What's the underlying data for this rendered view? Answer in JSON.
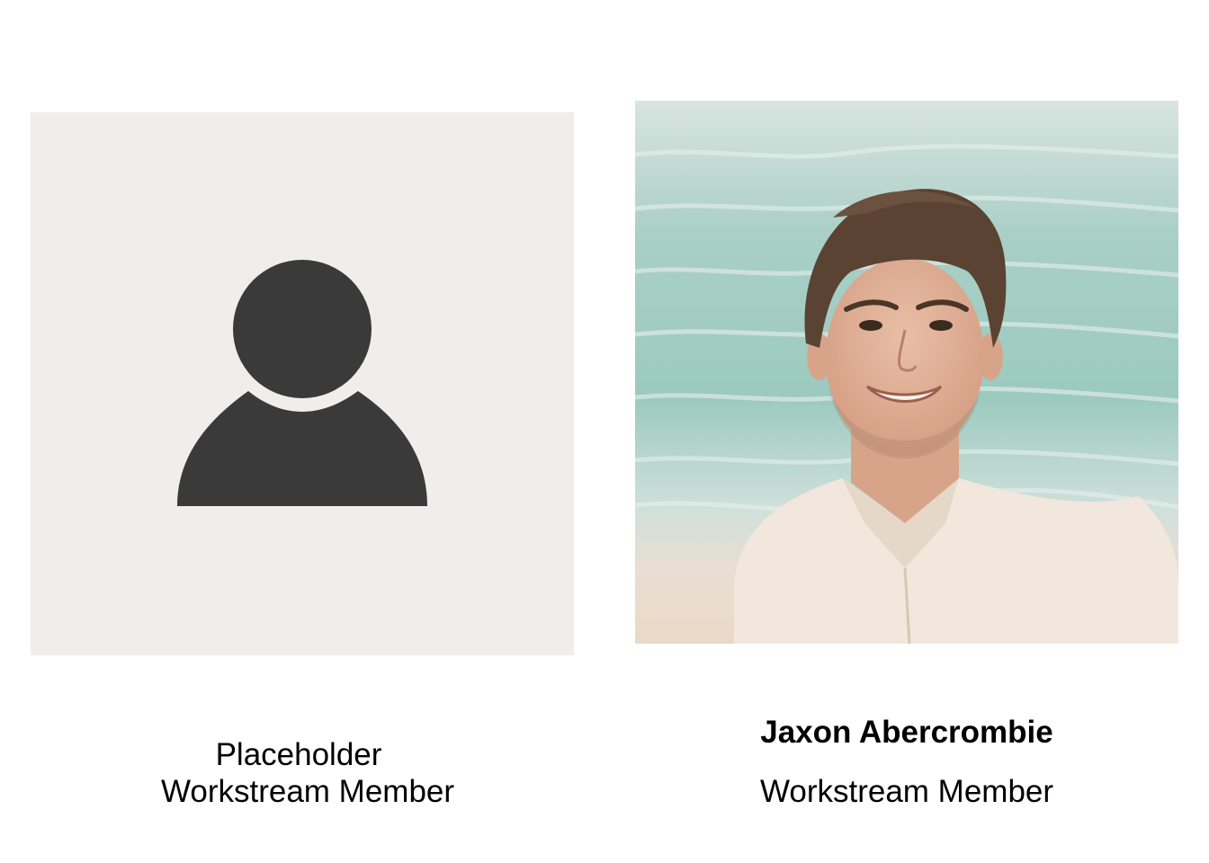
{
  "members": [
    {
      "name": "Placeholder",
      "role": "Workstream Member",
      "photo": "person-silhouette-icon"
    },
    {
      "name": "Jaxon Abercrombie",
      "role": "Workstream Member",
      "photo": "portrait-photo"
    }
  ],
  "colors": {
    "placeholder_background": "#efeeeb",
    "silhouette": "#3a3a3a",
    "text": "#000000"
  }
}
